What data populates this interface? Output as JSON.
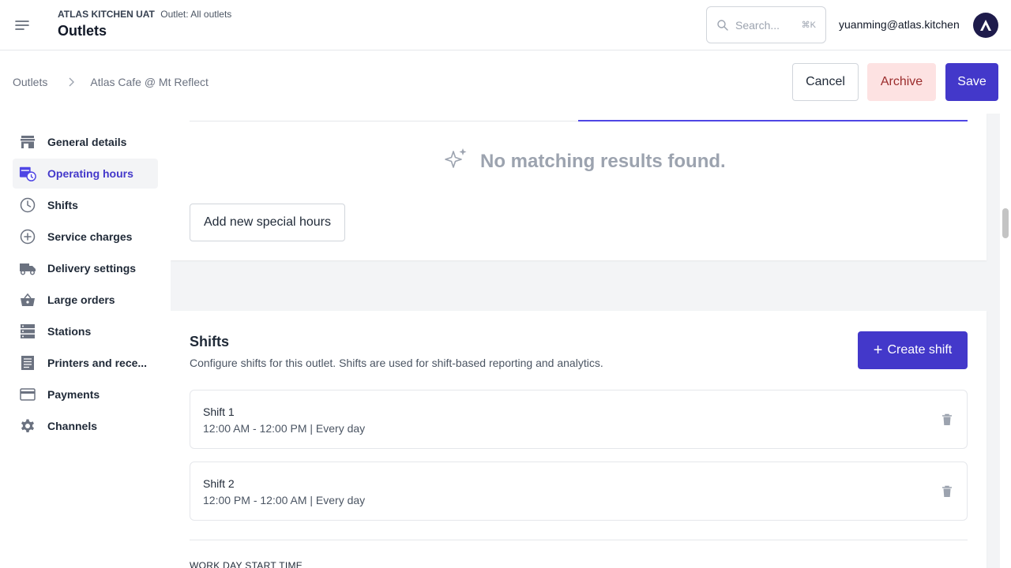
{
  "header": {
    "org_name": "ATLAS KITCHEN UAT",
    "outlet_filter": "Outlet: All outlets",
    "title": "Outlets",
    "search": {
      "placeholder": "Search...",
      "shortcut": "⌘K"
    },
    "user_email": "yuanming@atlas.kitchen"
  },
  "breadcrumb": {
    "root": "Outlets",
    "current": "Atlas Cafe @ Mt Reflect"
  },
  "actions": {
    "cancel": "Cancel",
    "archive": "Archive",
    "save": "Save"
  },
  "sidebar": {
    "items": [
      {
        "label": "General details",
        "icon": "store-icon"
      },
      {
        "label": "Operating hours",
        "icon": "calendar-clock-icon",
        "active": true
      },
      {
        "label": "Shifts",
        "icon": "clock-icon"
      },
      {
        "label": "Service charges",
        "icon": "plus-circle-icon"
      },
      {
        "label": "Delivery settings",
        "icon": "truck-icon"
      },
      {
        "label": "Large orders",
        "icon": "basket-icon"
      },
      {
        "label": "Stations",
        "icon": "server-icon"
      },
      {
        "label": "Printers and rece...",
        "icon": "receipt-icon"
      },
      {
        "label": "Payments",
        "icon": "credit-card-icon"
      },
      {
        "label": "Channels",
        "icon": "gear-icon"
      }
    ]
  },
  "special_hours": {
    "empty_text": "No matching results found.",
    "add_button": "Add new special hours"
  },
  "shifts": {
    "title": "Shifts",
    "description": "Configure shifts for this outlet. Shifts are used for shift-based reporting and analytics.",
    "create_button": "Create shift",
    "items": [
      {
        "name": "Shift 1",
        "time": "12:00 AM - 12:00 PM | Every day"
      },
      {
        "name": "Shift 2",
        "time": "12:00 PM - 12:00 AM | Every day"
      }
    ],
    "work_day_label": "WORK DAY START TIME"
  },
  "colors": {
    "accent": "#4338ca",
    "archive_bg": "#fde2e2",
    "archive_text": "#9b2c2c",
    "sidebar_icon": "#6b7280"
  }
}
